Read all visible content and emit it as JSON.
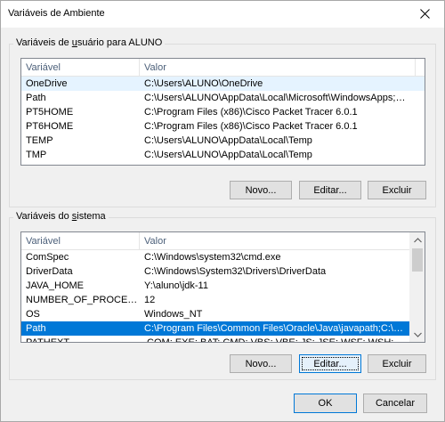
{
  "window": {
    "title": "Variáveis de Ambiente"
  },
  "user_vars": {
    "legend_pre": "Variáveis de ",
    "legend_u": "u",
    "legend_post": "suário para ALUNO",
    "headers": {
      "name": "Variável",
      "value": "Valor"
    },
    "rows": [
      {
        "name": "OneDrive",
        "value": "C:\\Users\\ALUNO\\OneDrive"
      },
      {
        "name": "Path",
        "value": "C:\\Users\\ALUNO\\AppData\\Local\\Microsoft\\WindowsApps;C:\\Users..."
      },
      {
        "name": "PT5HOME",
        "value": "C:\\Program Files (x86)\\Cisco Packet Tracer 6.0.1"
      },
      {
        "name": "PT6HOME",
        "value": "C:\\Program Files (x86)\\Cisco Packet Tracer 6.0.1"
      },
      {
        "name": "TEMP",
        "value": "C:\\Users\\ALUNO\\AppData\\Local\\Temp"
      },
      {
        "name": "TMP",
        "value": "C:\\Users\\ALUNO\\AppData\\Local\\Temp"
      }
    ],
    "buttons": {
      "new": "Novo...",
      "edit": "Editar...",
      "delete": "Excluir"
    }
  },
  "system_vars": {
    "legend_pre": "Variáveis do ",
    "legend_u": "s",
    "legend_post": "istema",
    "headers": {
      "name": "Variável",
      "value": "Valor"
    },
    "rows": [
      {
        "name": "ComSpec",
        "value": "C:\\Windows\\system32\\cmd.exe"
      },
      {
        "name": "DriverData",
        "value": "C:\\Windows\\System32\\Drivers\\DriverData"
      },
      {
        "name": "JAVA_HOME",
        "value": "Y:\\aluno\\jdk-11"
      },
      {
        "name": "NUMBER_OF_PROCESSORS",
        "value": "12"
      },
      {
        "name": "OS",
        "value": "Windows_NT"
      },
      {
        "name": "Path",
        "value": "C:\\Program Files\\Common Files\\Oracle\\Java\\javapath;C:\\Program ..."
      },
      {
        "name": "PATHEXT",
        "value": ".COM;.EXE;.BAT;.CMD;.VBS;.VBE;.JS;.JSE;.WSF;.WSH;.MSC"
      }
    ],
    "selected_index": 5,
    "buttons": {
      "new": "Novo...",
      "edit": "Editar...",
      "delete": "Excluir"
    }
  },
  "footer": {
    "ok": "OK",
    "cancel": "Cancelar"
  },
  "colors": {
    "selection": "#0078d7",
    "hover": "#e5f3ff",
    "header_text": "#4c607a"
  }
}
